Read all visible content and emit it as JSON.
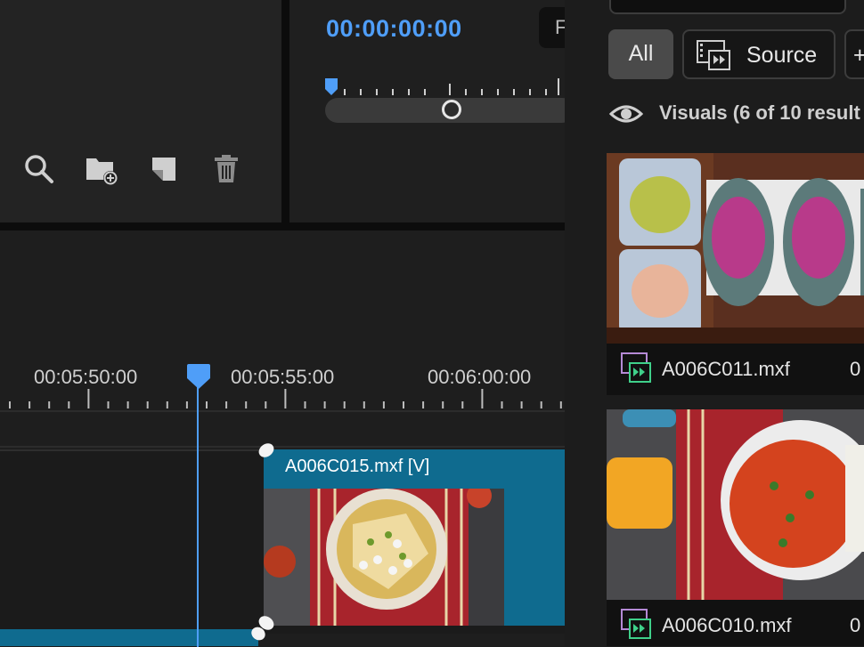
{
  "project_panel": {
    "tools": [
      {
        "name": "search-icon"
      },
      {
        "name": "new-bin-icon"
      },
      {
        "name": "new-item-icon"
      },
      {
        "name": "trash-icon"
      }
    ]
  },
  "program_monitor": {
    "timecode": "00:00:00:00",
    "button_label": "F"
  },
  "timeline": {
    "labels": [
      "00:05:50:00",
      "00:05:55:00",
      "00:06:00:00"
    ],
    "clip": {
      "title": "A006C015.mxf [V]"
    }
  },
  "right_panel": {
    "filters": {
      "all": "All",
      "source": "Source",
      "more": "+"
    },
    "results_label": "Visuals (6 of 10 result",
    "results": [
      {
        "name": "A006C011.mxf",
        "duration": "0"
      },
      {
        "name": "A006C010.mxf",
        "duration": "0"
      }
    ]
  },
  "colors": {
    "accent": "#4f9ef8",
    "clip": "#0f6b8f",
    "panel": "#232323"
  }
}
